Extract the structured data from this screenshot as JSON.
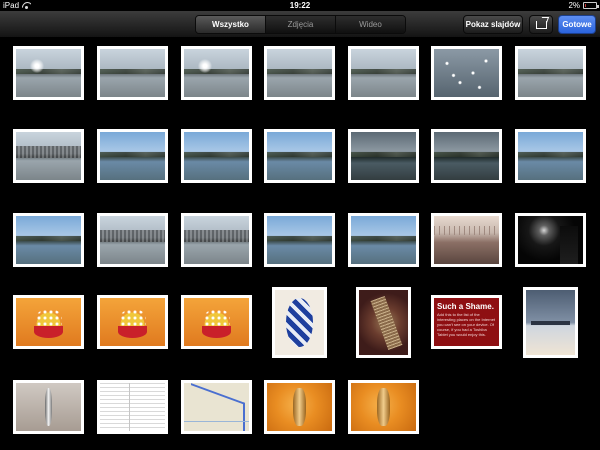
{
  "status_bar": {
    "device": "iPad",
    "time": "19:22",
    "battery": "2%",
    "battery_level": 0.02
  },
  "toolbar": {
    "segments": [
      "Wszystko",
      "Zdjęcia",
      "Wideo"
    ],
    "active_segment": "Wszystko",
    "slideshow_label": "Pokaz slajdów",
    "share_icon": "share-icon",
    "done_label": "Gotowe",
    "accent": "#2f6be0"
  },
  "thumbnail_text": {
    "shame_title": "Such a Shame.",
    "shame_body": "Add this to the list of the interesting places on the Internet you can't see on your device. Of course, if you had a Toshiba Tablet you would enjoy this."
  },
  "thumbnails": [
    {
      "row": 1,
      "kind": "lake-sun"
    },
    {
      "row": 1,
      "kind": "lake"
    },
    {
      "row": 1,
      "kind": "lake-sun"
    },
    {
      "row": 1,
      "kind": "lake"
    },
    {
      "row": 1,
      "kind": "lake"
    },
    {
      "row": 1,
      "kind": "sparkle-water"
    },
    {
      "row": 1,
      "kind": "lake"
    },
    {
      "row": 2,
      "kind": "lake-bare-trees"
    },
    {
      "row": 2,
      "kind": "lake-sky"
    },
    {
      "row": 2,
      "kind": "lake-sky"
    },
    {
      "row": 2,
      "kind": "lake-sky"
    },
    {
      "row": 2,
      "kind": "lake-dark"
    },
    {
      "row": 2,
      "kind": "lake-dark"
    },
    {
      "row": 2,
      "kind": "lake-sky"
    },
    {
      "row": 3,
      "kind": "lake-sky"
    },
    {
      "row": 3,
      "kind": "lake-bare-trees"
    },
    {
      "row": 3,
      "kind": "lake-bare-trees"
    },
    {
      "row": 3,
      "kind": "lake-sky"
    },
    {
      "row": 3,
      "kind": "lake-sky"
    },
    {
      "row": 3,
      "kind": "foggy-shore"
    },
    {
      "row": 3,
      "kind": "night-sky"
    },
    {
      "row": 4,
      "kind": "easter-egg"
    },
    {
      "row": 4,
      "kind": "easter-egg"
    },
    {
      "row": 4,
      "kind": "easter-egg"
    },
    {
      "row": 4,
      "kind": "blue-woven-egg"
    },
    {
      "row": 4,
      "kind": "wood-closeup"
    },
    {
      "row": 4,
      "kind": "such-a-shame-screenshot"
    },
    {
      "row": 4,
      "kind": "laptop-closeup"
    },
    {
      "row": 5,
      "kind": "silver-figurine"
    },
    {
      "row": 5,
      "kind": "document-screenshot"
    },
    {
      "row": 5,
      "kind": "map-screenshot"
    },
    {
      "row": 5,
      "kind": "orange-figurine"
    },
    {
      "row": 5,
      "kind": "orange-figurine"
    }
  ]
}
